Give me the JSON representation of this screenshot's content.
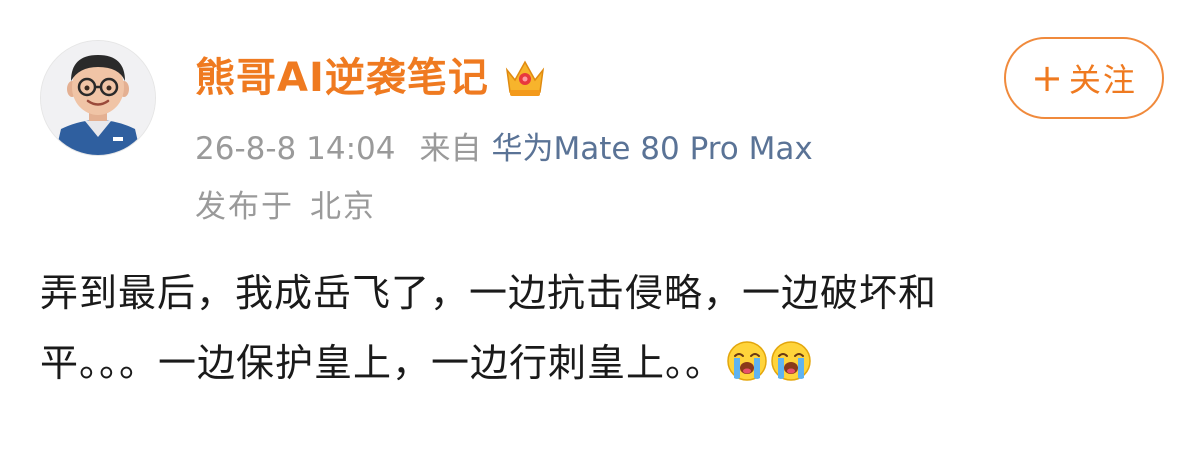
{
  "user": {
    "name": "熊哥AI逆袭笔记",
    "avatar_icon": "avatar-cartoon-man-icon",
    "badge_icon": "vip-crown-icon"
  },
  "post": {
    "timestamp": "26-8-8 14:04",
    "source_prefix": "来自",
    "device": "华为Mate 80 Pro Max",
    "location_label": "发布于",
    "location_value": "北京",
    "content_line1": "弄到最后，我成岳飞了，一边抗击侵略，一边破坏和",
    "content_line2": "平。。。一边保护皇上，一边行刺皇上。。",
    "emojis": [
      "crying-emoji-icon",
      "crying-emoji-icon"
    ]
  },
  "actions": {
    "follow_plus": "+",
    "follow_label": "关注"
  },
  "colors": {
    "username": "#ef7a20",
    "follow_border": "#f08a3c",
    "meta_gray": "#9a9a9a",
    "device_blue": "#5a7396",
    "body_text": "#1a1a1a"
  }
}
